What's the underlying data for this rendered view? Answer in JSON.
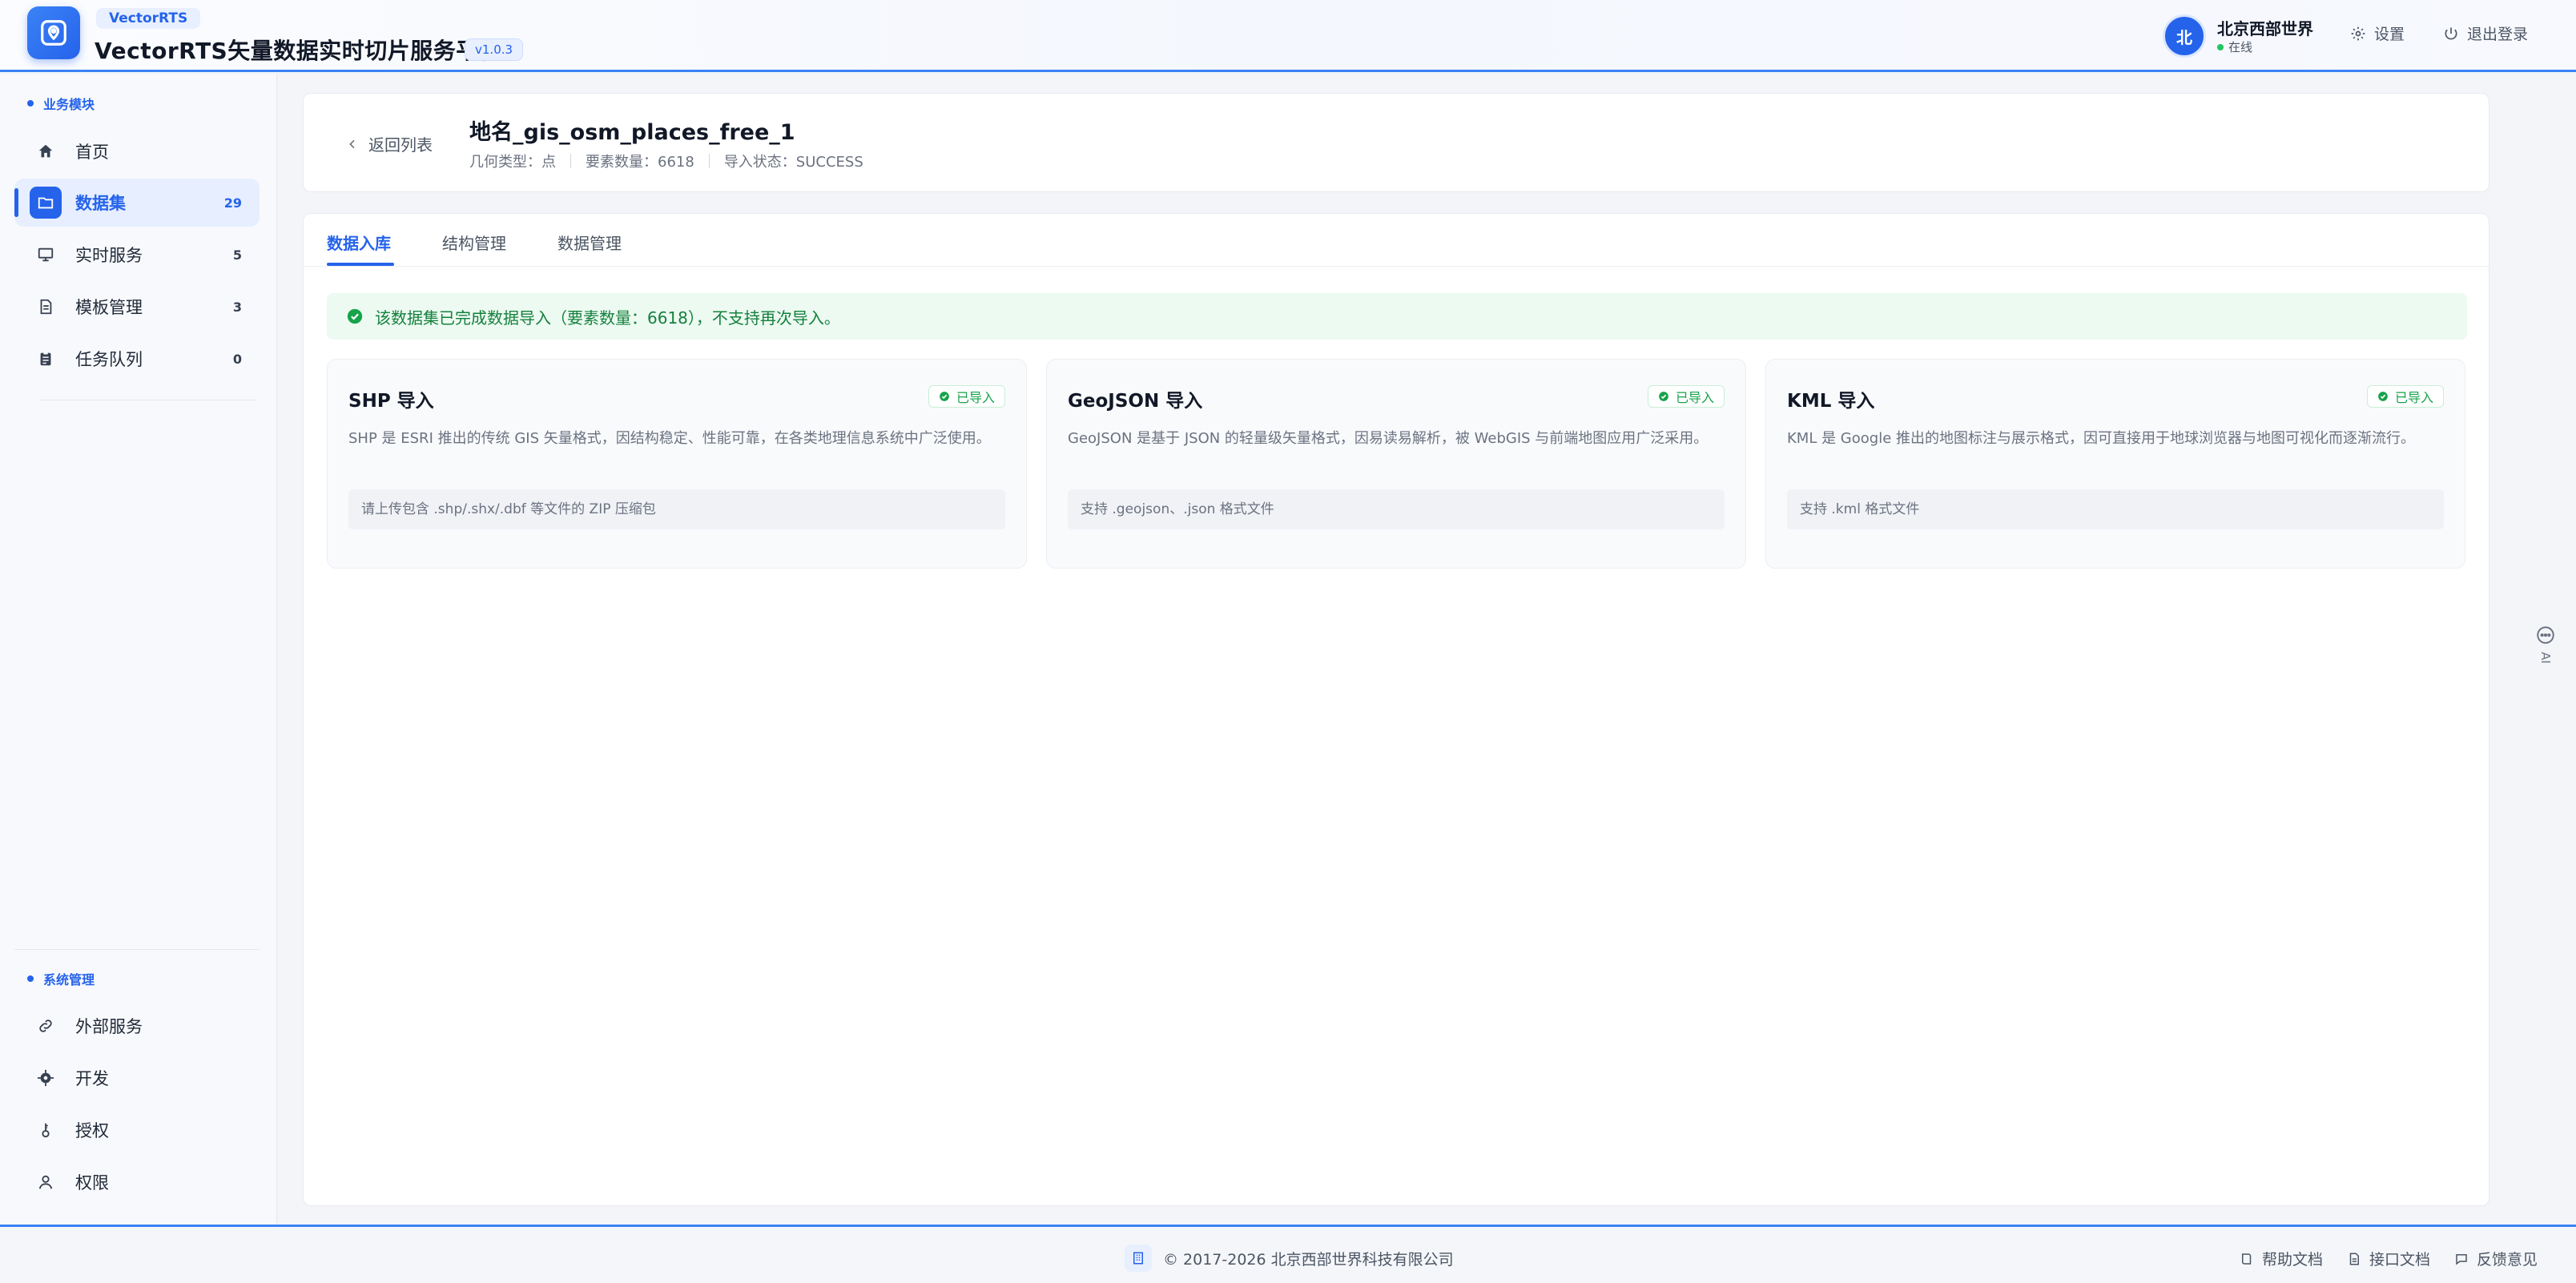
{
  "header": {
    "brand_tag": "VectorRTS",
    "title": "VectorRTS矢量数据实时切片服务平台",
    "version": "v1.0.3",
    "user": {
      "avatar_char": "北",
      "name": "北京西部世界",
      "status": "在线"
    },
    "settings_label": "设置",
    "logout_label": "退出登录"
  },
  "sidebar": {
    "business_section": "业务模块",
    "business_items": [
      {
        "label": "首页",
        "icon": "home-icon",
        "badge": ""
      },
      {
        "label": "数据集",
        "icon": "folder-icon",
        "badge": "29"
      },
      {
        "label": "实时服务",
        "icon": "monitor-icon",
        "badge": "5"
      },
      {
        "label": "模板管理",
        "icon": "document-icon",
        "badge": "3"
      },
      {
        "label": "任务队列",
        "icon": "clipboard-icon",
        "badge": "0"
      }
    ],
    "system_section": "系统管理",
    "system_items": [
      {
        "label": "外部服务",
        "icon": "link-icon"
      },
      {
        "label": "开发",
        "icon": "gear-icon"
      },
      {
        "label": "授权",
        "icon": "key-icon"
      },
      {
        "label": "权限",
        "icon": "user-icon"
      }
    ]
  },
  "dataset": {
    "back_label": "返回列表",
    "title": "地名_gis_osm_places_free_1",
    "geometry": "几何类型：点",
    "feature_count": "要素数量：6618",
    "import_status": "导入状态：SUCCESS"
  },
  "tabs": [
    "数据入库",
    "结构管理",
    "数据管理"
  ],
  "alert": "该数据集已完成数据导入（要素数量：6618），不支持再次导入。",
  "import_cards": [
    {
      "title": "SHP 导入",
      "badge": "已导入",
      "desc": "SHP 是 ESRI 推出的传统 GIS 矢量格式，因结构稳定、性能可靠，在各类地理信息系统中广泛使用。",
      "hint": "请上传包含 .shp/.shx/.dbf 等文件的 ZIP 压缩包"
    },
    {
      "title": "GeoJSON 导入",
      "badge": "已导入",
      "desc": "GeoJSON 是基于 JSON 的轻量级矢量格式，因易读易解析，被 WebGIS 与前端地图应用广泛采用。",
      "hint": "支持 .geojson、.json 格式文件"
    },
    {
      "title": "KML 导入",
      "badge": "已导入",
      "desc": "KML 是 Google 推出的地图标注与展示格式，因可直接用于地球浏览器与地图可视化而逐渐流行。",
      "hint": "支持 .kml 格式文件"
    }
  ],
  "ai_label": "AI",
  "footer": {
    "copyright": "© 2017-2026 北京西部世界科技有限公司",
    "help": "帮助文档",
    "api": "接口文档",
    "feedback": "反馈意见"
  },
  "colors": {
    "accent": "#2563eb",
    "success": "#16a34a",
    "alert_bg": "#ecfaf1"
  }
}
